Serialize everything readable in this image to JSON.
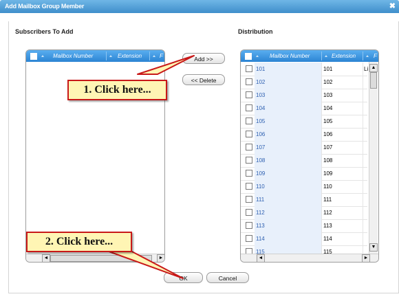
{
  "dialog": {
    "title": "Add Mailbox Group Member",
    "close_glyph": "✖"
  },
  "subscribers": {
    "label": "Subscribers To Add",
    "columns": [
      "Mailbox Number",
      "Extension",
      "F"
    ],
    "scroll_left": "◄",
    "scroll_right": "►"
  },
  "distribution": {
    "label": "Distribution",
    "columns": [
      "Mailbox Number",
      "Extension",
      "F"
    ],
    "first_name_partial": "Li",
    "rows": [
      {
        "mailbox": "101",
        "extension": "101"
      },
      {
        "mailbox": "102",
        "extension": "102"
      },
      {
        "mailbox": "103",
        "extension": "103"
      },
      {
        "mailbox": "104",
        "extension": "104"
      },
      {
        "mailbox": "105",
        "extension": "105"
      },
      {
        "mailbox": "106",
        "extension": "106"
      },
      {
        "mailbox": "107",
        "extension": "107"
      },
      {
        "mailbox": "108",
        "extension": "108"
      },
      {
        "mailbox": "109",
        "extension": "109"
      },
      {
        "mailbox": "110",
        "extension": "110"
      },
      {
        "mailbox": "111",
        "extension": "111"
      },
      {
        "mailbox": "112",
        "extension": "112"
      },
      {
        "mailbox": "113",
        "extension": "113"
      },
      {
        "mailbox": "114",
        "extension": "114"
      },
      {
        "mailbox": "115",
        "extension": "115"
      }
    ],
    "scroll_up": "▲",
    "scroll_down": "▼",
    "scroll_left": "◄",
    "scroll_right": "►"
  },
  "buttons": {
    "add": "Add >>",
    "delete": "<< Delete",
    "ok": "OK",
    "cancel": "Cancel"
  },
  "annotations": {
    "step1": "1. Click here...",
    "step2": "2. Click here...",
    "color": "#c81818",
    "fill": "#fff5b4"
  }
}
